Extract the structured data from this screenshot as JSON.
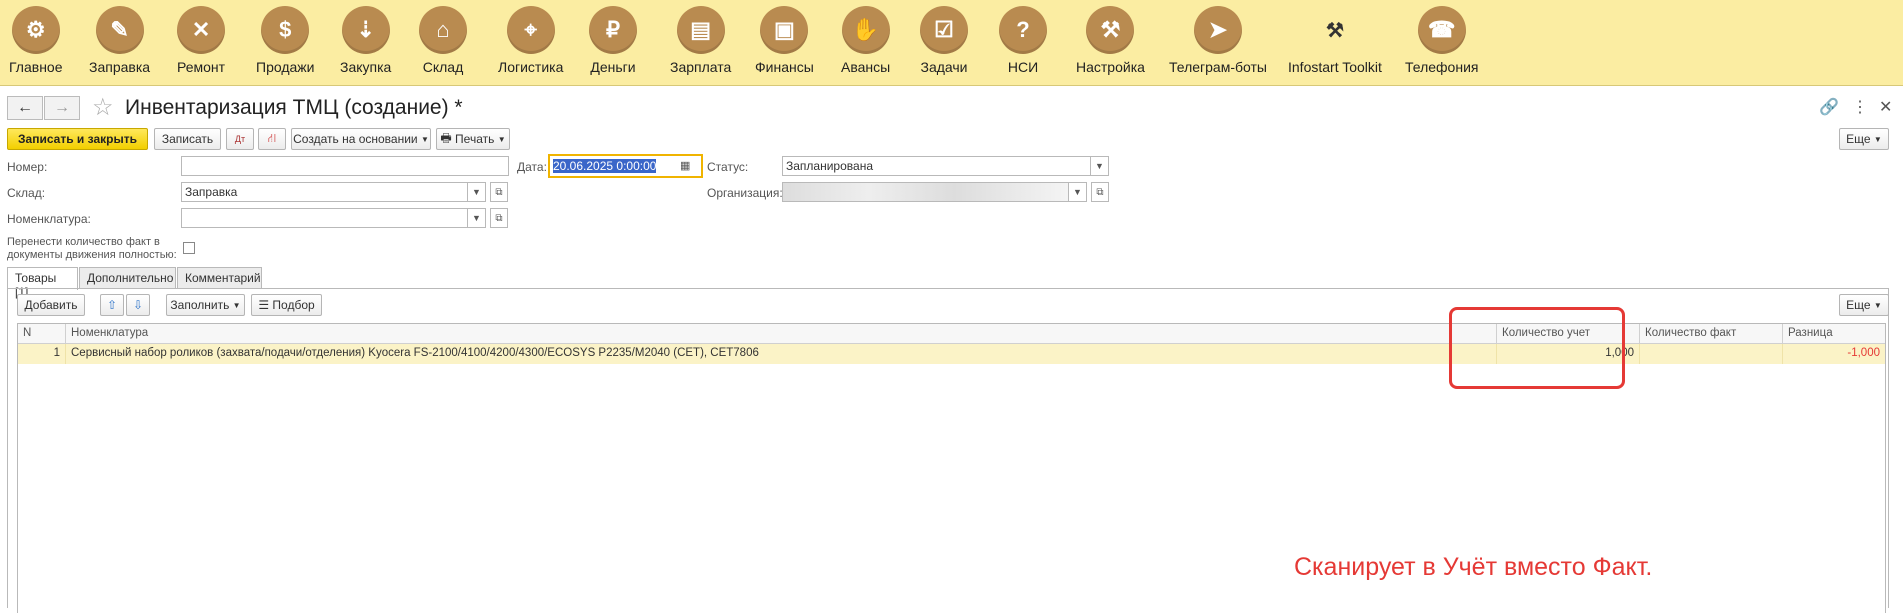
{
  "sections": [
    {
      "name": "main",
      "label": "Главное",
      "icon": "gears-icon"
    },
    {
      "name": "refuel",
      "label": "Заправка",
      "icon": "refill-icon"
    },
    {
      "name": "repair",
      "label": "Ремонт",
      "icon": "wrench-icon"
    },
    {
      "name": "sales",
      "label": "Продажи",
      "icon": "sale-icon"
    },
    {
      "name": "purchase",
      "label": "Закупка",
      "icon": "cart-icon"
    },
    {
      "name": "warehouse",
      "label": "Склад",
      "icon": "warehouse-icon"
    },
    {
      "name": "logistics",
      "label": "Логистика",
      "icon": "map-icon"
    },
    {
      "name": "money",
      "label": "Деньги",
      "icon": "money-bag-icon"
    },
    {
      "name": "salary",
      "label": "Зарплата",
      "icon": "wallet-icon"
    },
    {
      "name": "finance",
      "label": "Финансы",
      "icon": "briefcase-icon"
    },
    {
      "name": "advances",
      "label": "Авансы",
      "icon": "hand-money-icon"
    },
    {
      "name": "tasks",
      "label": "Задачи",
      "icon": "checklist-icon"
    },
    {
      "name": "nsi",
      "label": "НСИ",
      "icon": "book-icon"
    },
    {
      "name": "settings",
      "label": "Настройка",
      "icon": "gear-wrench-icon"
    },
    {
      "name": "telegram",
      "label": "Телеграм-боты",
      "icon": "paper-plane-icon"
    },
    {
      "name": "toolkit",
      "label": "Infostart Toolkit",
      "icon": "tools-icon"
    },
    {
      "name": "phone",
      "label": "Телефония",
      "icon": "phone-icon"
    }
  ],
  "form": {
    "title": "Инвентаризация ТМЦ (создание) *",
    "toolbar": {
      "save_close": "Записать и закрыть",
      "save": "Записать",
      "create_based": "Создать на основании",
      "print": "Печать",
      "more": "Еще"
    },
    "fields": {
      "number_label": "Номер:",
      "number_value": "",
      "date_label": "Дата:",
      "date_value": "20.06.2025  0:00:00",
      "status_label": "Статус:",
      "status_value": "Запланирована",
      "warehouse_label": "Склад:",
      "warehouse_value": "Заправка",
      "org_label": "Организация:",
      "org_value": "",
      "nomenclature_label": "Номенклатура:",
      "nomenclature_value": "",
      "transfer_label_1": "Перенести количество факт в",
      "transfer_label_2": "документы движения полностью:",
      "transfer_checked": false
    },
    "tabs": [
      "Товары [1]",
      "Дополнительно",
      "Комментарий"
    ],
    "table_toolbar": {
      "add": "Добавить",
      "fill": "Заполнить",
      "pick": "Подбор",
      "more": "Еще"
    },
    "table": {
      "columns": [
        "N",
        "Номенклатура",
        "Количество учет",
        "Количество факт",
        "Разница"
      ],
      "rows": [
        {
          "n": "1",
          "item": "Сервисный набор роликов (захвата/подачи/отделения) Kyocera FS-2100/4100/4200/4300/ECOSYS P2235/M2040 (CET), CET7806",
          "qty_account": "1,000",
          "qty_fact": "",
          "diff": "-1,000"
        }
      ]
    },
    "annotation": "Сканирует в Учёт вместо Факт."
  },
  "colors": {
    "top_bar": "#fbeda2",
    "icon_circle": "#b98b50",
    "primary_button": "#f2cf00",
    "highlight": "#e53935",
    "selected_row": "#fbf3c7"
  }
}
